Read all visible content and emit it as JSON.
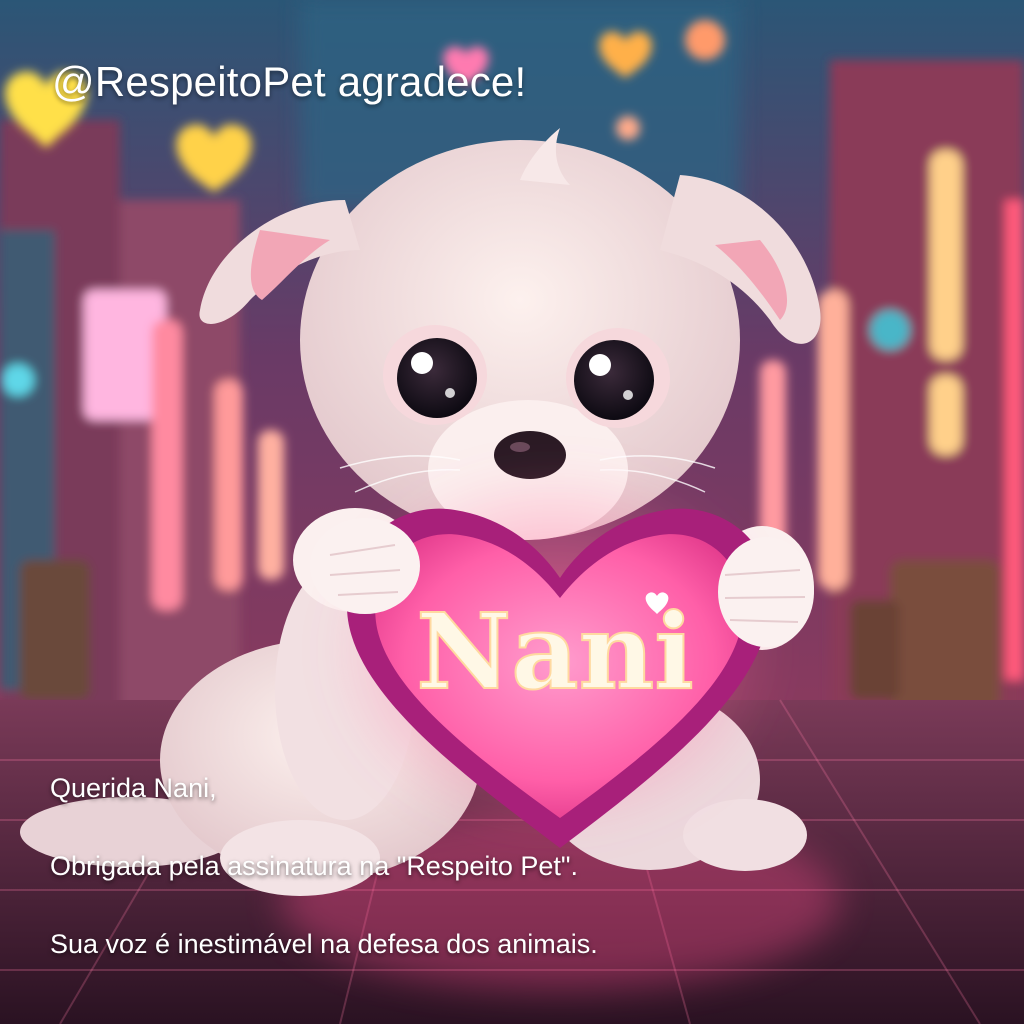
{
  "header": {
    "title": "@RespeitoPet agradece!"
  },
  "heart": {
    "name": "Nani"
  },
  "message": {
    "greeting": "Querida Nani,",
    "thanks": "Obrigada pela assinatura na \"Respeito Pet\".",
    "closing": "Sua voz é inestimável na defesa dos animais."
  },
  "colors": {
    "heart": "#ff5fa8",
    "heart_rim": "#a8207a",
    "neon": "#ff3d7a",
    "sky": "#2d5a7a"
  },
  "icons": [
    "floating-heart-icon",
    "heart-icon"
  ]
}
